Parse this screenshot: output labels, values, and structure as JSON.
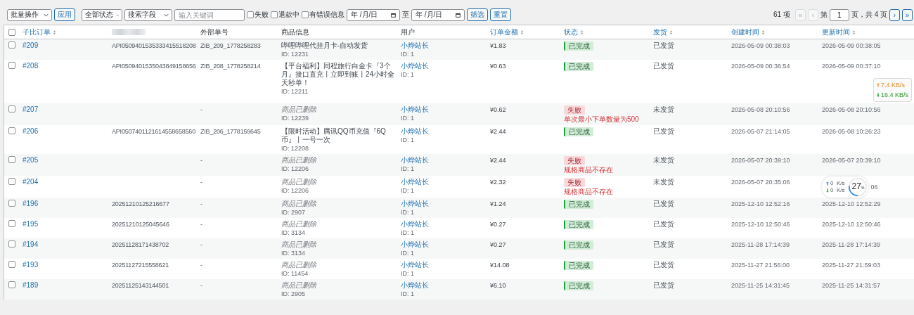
{
  "toolbar": {
    "bulk_select": "批量操作",
    "apply": "应用",
    "status_select": "全部状态",
    "field_select": "搜索字段",
    "keyword": {
      "placeholder": "输入关键词"
    },
    "checkboxes": [
      {
        "label": "失败",
        "checked": false
      },
      {
        "label": "退款中",
        "checked": false
      },
      {
        "label": "有错误信息",
        "checked": false
      }
    ],
    "date_from": {
      "placeholder": "年 /月/日"
    },
    "date_sep": "至",
    "date_to": {
      "placeholder": "年 /月/日"
    },
    "filter": "筛选",
    "reset": "重置"
  },
  "pagination": {
    "count": "61 项",
    "first": {
      "label": "«",
      "disabled": true
    },
    "prev": {
      "label": "‹",
      "disabled": true
    },
    "page_prefix": "第",
    "page": "1",
    "page_suffix": "页，共 4 页",
    "next": {
      "label": "›",
      "disabled": false
    },
    "last": {
      "label": "»",
      "disabled": false
    }
  },
  "header_checkbox": {
    "checked": false
  },
  "columns": [
    {
      "label": "子比订单",
      "sortable": true
    },
    {
      "redacted": true,
      "sortable": false
    },
    {
      "label": "外部单号",
      "sortable": false
    },
    {
      "label": "商品信息",
      "sortable": false
    },
    {
      "label": "用户",
      "sortable": false
    },
    {
      "label": "订单金额",
      "sortable": true
    },
    {
      "label": "状态",
      "sortable": true
    },
    {
      "label": "发货",
      "sortable": true
    },
    {
      "label": "创建时间",
      "sortable": true
    },
    {
      "label": "更新时间",
      "sortable": true
    }
  ],
  "rows": [
    {
      "checked": false,
      "order": "#209",
      "api": "API0509401535333415518208",
      "external": "ZIB_209_1778258283",
      "product": "哔哩哔哩代挂月卡-自动发货",
      "product_deleted": false,
      "product_id": "ID: 12231",
      "user": "小烨站长",
      "user_id": "ID: 1",
      "amount": "¥1.83",
      "status": {
        "label": "已完成",
        "kind": "done"
      },
      "shipping": "已发货",
      "created": "2026-05-09 00:38:03",
      "updated": "2026-05-09 00:38:05"
    },
    {
      "checked": false,
      "order": "#208",
      "api": "API0509401535043849158656",
      "external": "ZIB_208_1778258214",
      "product": "【平台福利】同程旅行白金卡『3个月』接口直充丨立即到账丨24小时全天秒单！",
      "product_deleted": false,
      "product_id": "ID: 12211",
      "user": "小烨站长",
      "user_id": "ID: 1",
      "amount": "¥0.63",
      "status": {
        "label": "已完成",
        "kind": "done"
      },
      "shipping": "已发货",
      "created": "2026-05-09 00:36:54",
      "updated": "2026-05-09 00:37:10",
      "widget": {
        "kind": "speed",
        "up": "7.4 KB/s",
        "down": "16.4 KB/s"
      }
    },
    {
      "checked": false,
      "order": "#207",
      "external": "-",
      "product": "商品已删除",
      "product_deleted": true,
      "product_id": "ID: 12239",
      "user": "小烨站长",
      "user_id": "ID: 1",
      "amount": "¥0.62",
      "status": {
        "label": "失败",
        "kind": "failed"
      },
      "error": "单次最小下单数量为500",
      "shipping": "未发货",
      "created": "2026-05-08 20:10:56",
      "updated": "2026-05-08 20:10:56"
    },
    {
      "checked": false,
      "order": "#206",
      "api": "API0507401121614558658560",
      "external": "ZIB_206_1778159645",
      "product": "【限时活动】腾讯QQ币充值『6Q币』丨一号一次",
      "product_deleted": false,
      "product_id": "ID: 12208",
      "user": "小烨站长",
      "user_id": "ID: 1",
      "amount": "¥2.44",
      "status": {
        "label": "已完成",
        "kind": "done"
      },
      "shipping": "已发货",
      "created": "2026-05-07 21:14:05",
      "updated": "2026-05-08 10:26:23"
    },
    {
      "checked": false,
      "order": "#205",
      "external": "-",
      "product": "商品已删除",
      "product_deleted": true,
      "product_id": "ID: 12206",
      "user": "小烨站长",
      "user_id": "ID: 1",
      "amount": "¥2.44",
      "status": {
        "label": "失败",
        "kind": "failed"
      },
      "error": "规格商品不存在",
      "shipping": "未发货",
      "created": "2026-05-07 20:39:10",
      "updated": "2026-05-07 20:39:10"
    },
    {
      "checked": false,
      "order": "#204",
      "external": "-",
      "product": "商品已删除",
      "product_deleted": true,
      "product_id": "ID: 12206",
      "user": "小烨站长",
      "user_id": "ID: 1",
      "amount": "¥2.32",
      "status": {
        "label": "失败",
        "kind": "failed"
      },
      "error": "规格商品不存在",
      "shipping": "未发货",
      "created": "2026-05-07 20:35:06",
      "updated": "06",
      "widget": {
        "kind": "monitor",
        "up": "0  K/s",
        "down": "0  K/s",
        "percent": "27",
        "unit": "%",
        "level": 0.27
      }
    },
    {
      "checked": false,
      "order": "#196",
      "api": "20251210125216677",
      "external": "-",
      "product": "商品已删除",
      "product_deleted": true,
      "product_id": "ID: 2907",
      "user": "小烨站长",
      "user_id": "ID: 1",
      "amount": "¥1.24",
      "status": {
        "label": "已完成",
        "kind": "done"
      },
      "shipping": "已发货",
      "created": "2025-12-10 12:52:16",
      "updated": "2025-12-10 12:52:29"
    },
    {
      "checked": false,
      "order": "#195",
      "api": "20251210125045646",
      "external": "-",
      "product": "商品已删除",
      "product_deleted": true,
      "product_id": "ID: 3134",
      "user": "小烨站长",
      "user_id": "ID: 1",
      "amount": "¥0.27",
      "status": {
        "label": "已完成",
        "kind": "done"
      },
      "shipping": "已发货",
      "created": "2025-12-10 12:50:46",
      "updated": "2025-12-10 12:50:46"
    },
    {
      "checked": false,
      "order": "#194",
      "api": "20251128171438702",
      "external": "-",
      "product": "商品已删除",
      "product_deleted": true,
      "product_id": "ID: 3134",
      "user": "小烨站长",
      "user_id": "ID: 1",
      "amount": "¥0.27",
      "status": {
        "label": "已完成",
        "kind": "done"
      },
      "shipping": "已发货",
      "created": "2025-11-28 17:14:39",
      "updated": "2025-11-28 17:14:39"
    },
    {
      "checked": false,
      "order": "#193",
      "api": "20251127215558621",
      "external": "-",
      "product": "商品已删除",
      "product_deleted": true,
      "product_id": "ID: 11454",
      "user": "小烨站长",
      "user_id": "ID: 1",
      "amount": "¥14.08",
      "status": {
        "label": "已完成",
        "kind": "done"
      },
      "shipping": "已发货",
      "created": "2025-11-27 21:56:00",
      "updated": "2025-11-27 21:59:03"
    },
    {
      "checked": false,
      "order": "#189",
      "api": "20251125143144501",
      "external": "-",
      "product": "商品已删除",
      "product_deleted": true,
      "product_id": "ID: 2905",
      "user": "小烨站长",
      "user_id": "ID: 1",
      "amount": "¥6.10",
      "status": {
        "label": "已完成",
        "kind": "done"
      },
      "shipping": "已发货",
      "created": "2025-11-25 14:31:45",
      "updated": "2025-11-25 14:31:57"
    }
  ]
}
